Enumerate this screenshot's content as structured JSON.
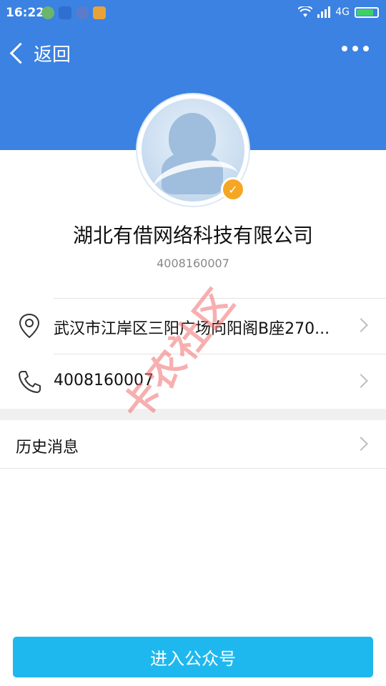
{
  "status_bar": {
    "time": "16:22",
    "network": "4G"
  },
  "header": {
    "back_label": "返回"
  },
  "profile": {
    "name": "湖北有借网络科技有限公司",
    "id_number": "4008160007"
  },
  "info": {
    "address": "武汉市江岸区三阳广场向阳阁B座270...",
    "phone": "4008160007"
  },
  "history": {
    "label": "历史消息"
  },
  "action": {
    "enter_label": "进入公众号"
  },
  "watermark": {
    "text": "卡农社区"
  },
  "colors": {
    "header_blue": "#3b82e2",
    "button_blue": "#1fb8ee",
    "badge_orange": "#f5a623"
  }
}
